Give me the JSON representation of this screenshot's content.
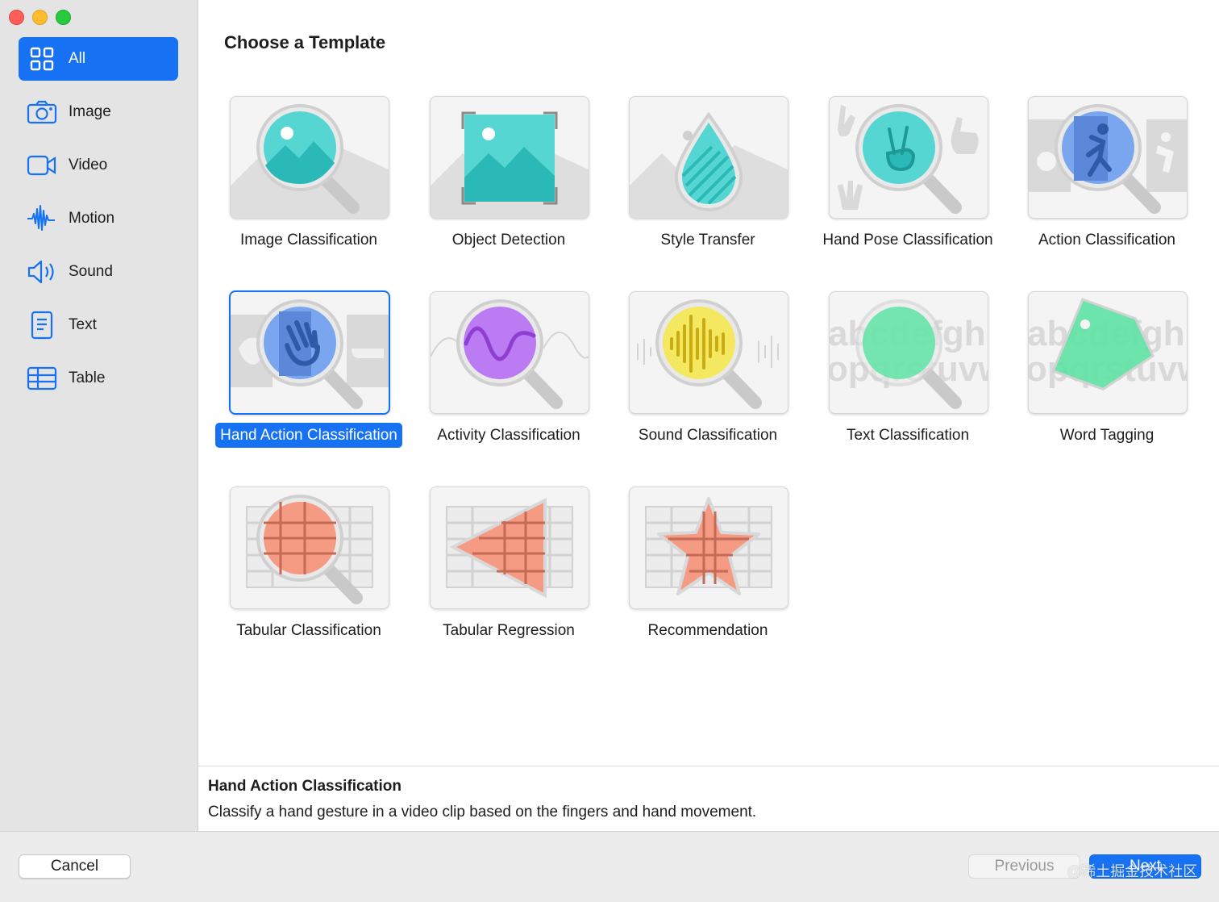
{
  "window": {
    "title": "Choose a Template"
  },
  "sidebar": {
    "items": [
      {
        "label": "All",
        "icon": "grid-icon",
        "selected": true
      },
      {
        "label": "Image",
        "icon": "camera-icon"
      },
      {
        "label": "Video",
        "icon": "video-camera-icon"
      },
      {
        "label": "Motion",
        "icon": "waveform-motion-icon"
      },
      {
        "label": "Sound",
        "icon": "speaker-icon"
      },
      {
        "label": "Text",
        "icon": "document-text-icon"
      },
      {
        "label": "Table",
        "icon": "table-icon"
      }
    ]
  },
  "templates": [
    {
      "label": "Image Classification",
      "icon": "image-magnifier-icon"
    },
    {
      "label": "Object Detection",
      "icon": "image-frame-icon"
    },
    {
      "label": "Style Transfer",
      "icon": "drop-icon"
    },
    {
      "label": "Hand Pose Classification",
      "icon": "hand-pose-magnifier-icon"
    },
    {
      "label": "Action Classification",
      "icon": "action-magnifier-icon"
    },
    {
      "label": "Hand Action Classification",
      "icon": "hand-wave-magnifier-icon",
      "selected": true
    },
    {
      "label": "Activity Classification",
      "icon": "wave-magnifier-icon"
    },
    {
      "label": "Sound Classification",
      "icon": "audio-magnifier-icon"
    },
    {
      "label": "Text Classification",
      "icon": "text-magnifier-icon",
      "text1": "abcdefghi",
      "text2": "opqrstuvw"
    },
    {
      "label": "Word Tagging",
      "icon": "tag-icon",
      "text1": "abcdefghi",
      "text2": "opqrstuvw"
    },
    {
      "label": "Tabular Classification",
      "icon": "table-magnifier-icon"
    },
    {
      "label": "Tabular Regression",
      "icon": "table-triangle-icon"
    },
    {
      "label": "Recommendation",
      "icon": "table-star-icon"
    }
  ],
  "description": {
    "title": "Hand Action Classification",
    "text": "Classify a hand gesture in a video clip based on the fingers and hand movement."
  },
  "footer": {
    "cancel_label": "Cancel",
    "previous_label": "Previous",
    "next_label": "Next",
    "watermark": "@稀土掘金技术社区"
  },
  "colors": {
    "accent": "#1672f3",
    "sidebar_bg": "#e4e4e4"
  }
}
